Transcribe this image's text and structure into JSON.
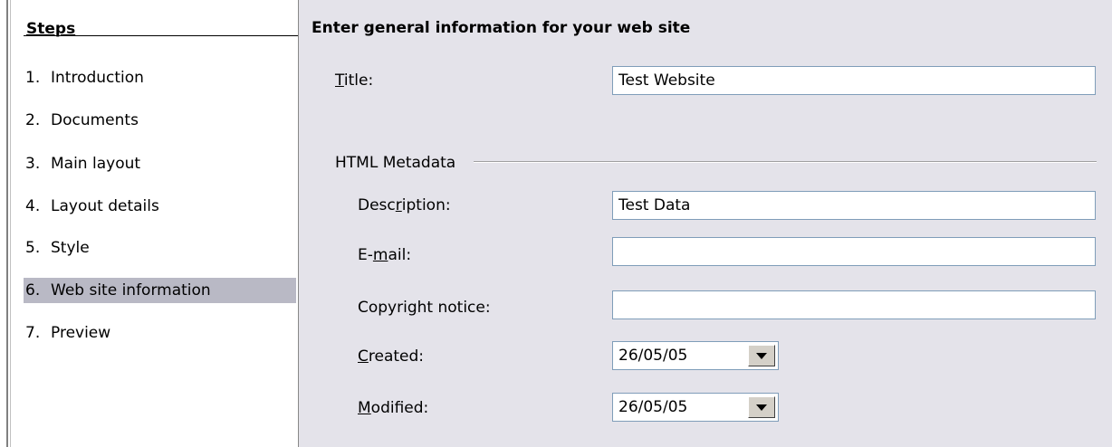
{
  "steps": {
    "header": "Steps",
    "items": [
      {
        "num": "1.",
        "label": "Introduction",
        "selected": false
      },
      {
        "num": "2.",
        "label": "Documents",
        "selected": false
      },
      {
        "num": "3.",
        "label": "Main layout",
        "selected": false
      },
      {
        "num": "4.",
        "label": "Layout details",
        "selected": false
      },
      {
        "num": "5.",
        "label": "Style",
        "selected": false
      },
      {
        "num": "6.",
        "label": "Web site information",
        "selected": true
      },
      {
        "num": "7.",
        "label": "Preview",
        "selected": false
      }
    ]
  },
  "main": {
    "heading": "Enter general information for your web site",
    "title": {
      "label_pre": "",
      "label_key": "T",
      "label_post": "itle:",
      "value": "Test Website"
    },
    "metadata_group": "HTML Metadata",
    "description": {
      "label_pre": "Desc",
      "label_key": "r",
      "label_post": "iption:",
      "value": "Test Data"
    },
    "email": {
      "label_pre": "E-",
      "label_key": "m",
      "label_post": "ail:",
      "value": ""
    },
    "copyright": {
      "label_pre": "Copyri",
      "label_key": "g",
      "label_post": "ht notice:",
      "value": ""
    },
    "created": {
      "label_pre": "",
      "label_key": "C",
      "label_post": "reated:",
      "value": "26/05/05"
    },
    "modified": {
      "label_pre": "",
      "label_key": "M",
      "label_post": "odified:",
      "value": "26/05/05"
    }
  },
  "colors": {
    "dialog_background": "#e4e3ea",
    "selected_step": "#b9b9c5",
    "input_border": "#7f9db9"
  },
  "icons": {
    "date_dropdown": "chevron-down-icon"
  }
}
